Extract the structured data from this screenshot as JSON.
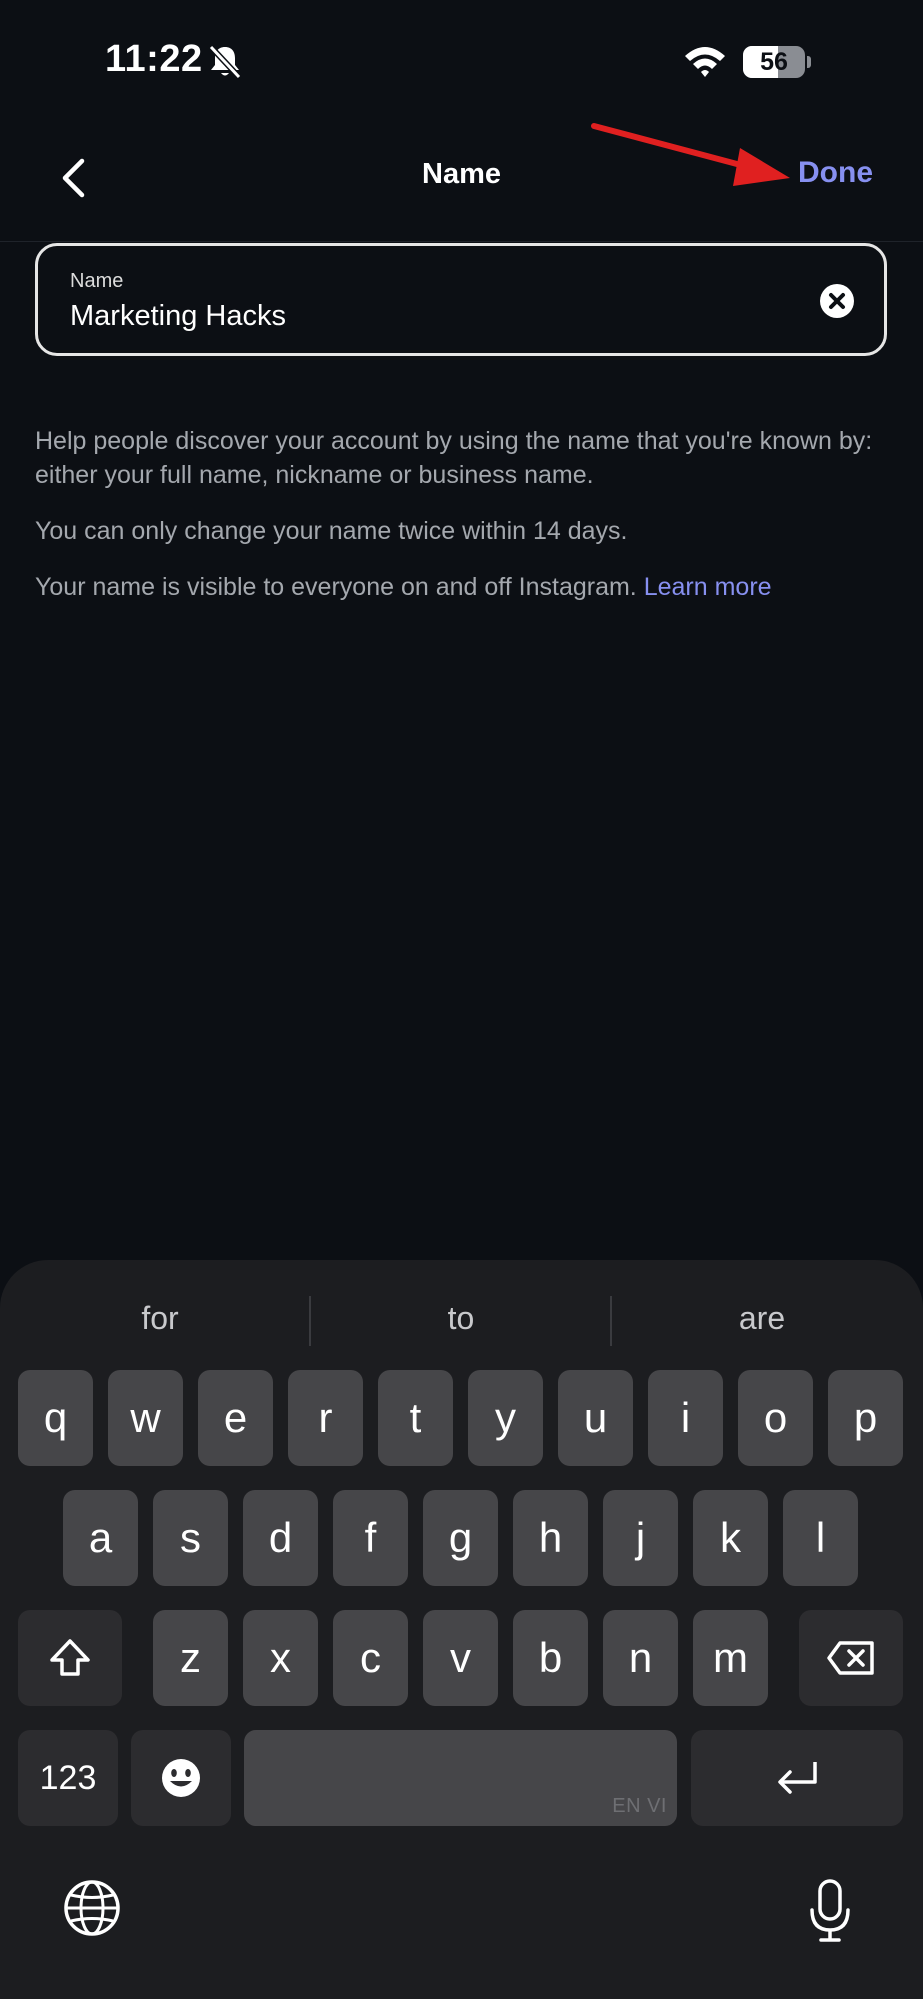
{
  "status_bar": {
    "time": "11:22",
    "battery": "56",
    "icons": [
      "bell-slash-icon",
      "wifi-icon",
      "battery-icon"
    ]
  },
  "nav": {
    "title": "Name",
    "done_label": "Done",
    "back_icon": "chevron-left-icon"
  },
  "name_field": {
    "label": "Name",
    "value": "Marketing Hacks",
    "clear_icon": "clear-icon"
  },
  "help": {
    "line1": "Help people discover your account by using the name that you're known by: either your full name, nickname or business name.",
    "line2": "You can only change your name twice within 14 days.",
    "line3": "Your name is visible to everyone on and off Instagram. ",
    "learn_more": "Learn more"
  },
  "keyboard": {
    "suggestions": [
      "for",
      "to",
      "are"
    ],
    "row1": [
      "q",
      "w",
      "e",
      "r",
      "t",
      "y",
      "u",
      "i",
      "o",
      "p"
    ],
    "row2": [
      "a",
      "s",
      "d",
      "f",
      "g",
      "h",
      "j",
      "k",
      "l"
    ],
    "row3": [
      "z",
      "x",
      "c",
      "v",
      "b",
      "n",
      "m"
    ],
    "numbers_label": "123",
    "space_languages": "EN VI"
  },
  "colors": {
    "background": "#0c0f14",
    "accent": "#8790f0",
    "annotation_arrow": "#e02020",
    "key": "#464649",
    "keyboard_bg": "#1c1d20"
  }
}
